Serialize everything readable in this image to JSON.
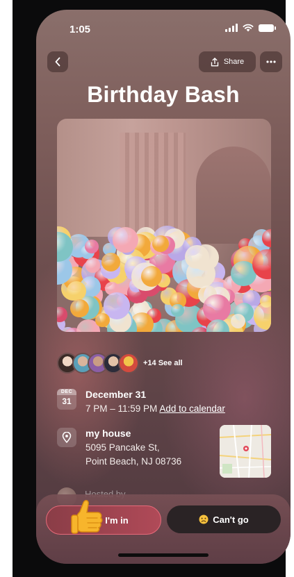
{
  "status_bar": {
    "time": "1:05"
  },
  "nav": {
    "share_label": "Share"
  },
  "event": {
    "title": "Birthday Bash"
  },
  "attendees": {
    "more_label": "+14 See all"
  },
  "date": {
    "month": "DEC",
    "day": "31",
    "main": "December 31",
    "time_range": "7 PM – 11:59 PM",
    "calendar_link": "Add to calendar"
  },
  "location": {
    "name": "my house",
    "address_line1": "5095 Pancake St,",
    "address_line2": "Point Beach, NJ 08736"
  },
  "host": {
    "label": "Hosted by"
  },
  "actions": {
    "im_in_label": "I'm in",
    "cant_go_label": "Can't go"
  },
  "colors": {
    "accent": "#e66a7a",
    "cant_go_bg": "#2a2325"
  }
}
